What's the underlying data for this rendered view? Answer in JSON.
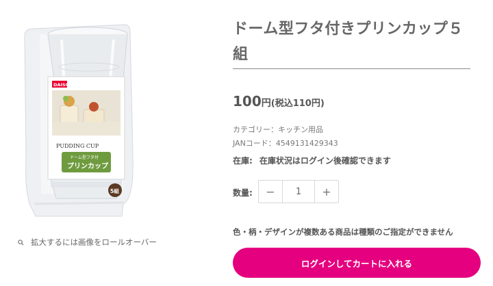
{
  "product": {
    "title": "ドーム型フタ付きプリンカップ５組",
    "price_number": "100",
    "price_yen": "円",
    "price_tax": "(税込110円)",
    "category": "カテゴリー：キッチン用品",
    "jan": "JANコード：4549131429343",
    "stock_label": "在庫:",
    "stock_value": "在庫状況はログイン後確認できます",
    "qty_label": "数量:",
    "qty_value": "1",
    "decrement": "−",
    "increment": "+",
    "note": "色・柄・デザインが複数ある商品は種類のご指定ができません",
    "cart_button": "ログインしてカートに入れる",
    "zoom_hint": "拡大するには画像をロールオーバー"
  },
  "package": {
    "brand": "DAISO",
    "label_en": "PUDDING CUP",
    "label_jp_small": "ドーム型フタ付",
    "label_jp": "プリンカップ",
    "count": "5組"
  },
  "icons": {
    "zoom": "search-icon"
  },
  "colors": {
    "accent": "#e5007f",
    "divider": "#8a8a8a"
  }
}
